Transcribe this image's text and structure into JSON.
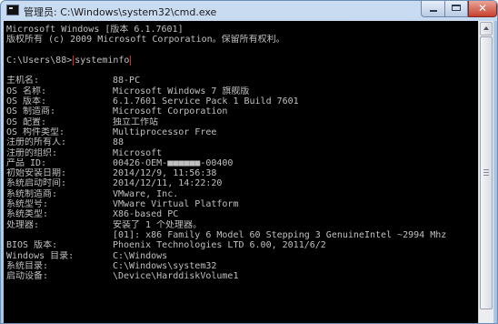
{
  "window": {
    "title": "管理员: C:\\Windows\\system32\\cmd.exe",
    "close_glyph": "✕"
  },
  "console": {
    "banner": [
      "Microsoft Windows [版本 6.1.7601]",
      "版权所有 (c) 2009 Microsoft Corporation。保留所有权利。"
    ],
    "prompt": "C:\\Users\\88>",
    "command": "systeminfo",
    "rows": [
      {
        "label": "主机名:",
        "value": "88-PC"
      },
      {
        "label": "OS 名称:",
        "value": "Microsoft Windows 7 旗舰版"
      },
      {
        "label": "OS 版本:",
        "value": "6.1.7601 Service Pack 1 Build 7601"
      },
      {
        "label": "OS 制造商:",
        "value": "Microsoft Corporation"
      },
      {
        "label": "OS 配置:",
        "value": "独立工作站"
      },
      {
        "label": "OS 构件类型:",
        "value": "Multiprocessor Free"
      },
      {
        "label": "注册的所有人:",
        "value": "88"
      },
      {
        "label": "注册的组织:",
        "value": "Microsoft"
      },
      {
        "label": "产品 ID:",
        "value": "00426-OEM-■■■■■■-00400"
      },
      {
        "label": "初始安装日期:",
        "value": "2014/12/9, 11:56:38"
      },
      {
        "label": "系统启动时间:",
        "value": "2014/12/11, 14:22:20"
      },
      {
        "label": "系统制造商:",
        "value": "VMware, Inc."
      },
      {
        "label": "系统型号:",
        "value": "VMware Virtual Platform"
      },
      {
        "label": "系统类型:",
        "value": "X86-based PC"
      },
      {
        "label": "处理器:",
        "value": "安装了 1 个处理器。"
      },
      {
        "label": "",
        "value": "[01]: x86 Family 6 Model 60 Stepping 3 GenuineIntel ~2994 Mhz"
      },
      {
        "label": "BIOS 版本:",
        "value": "Phoenix Technologies LTD 6.00, 2011/6/2"
      },
      {
        "label": "Windows 目录:",
        "value": "C:\\Windows"
      },
      {
        "label": "系统目录:",
        "value": "C:\\Windows\\system32"
      },
      {
        "label": "启动设备:",
        "value": "\\Device\\HarddiskVolume1"
      }
    ]
  },
  "colors": {
    "console_bg": "#000000",
    "console_text": "#c0c0c0",
    "highlight_border": "#e0202a",
    "close_button": "#c8402e"
  }
}
